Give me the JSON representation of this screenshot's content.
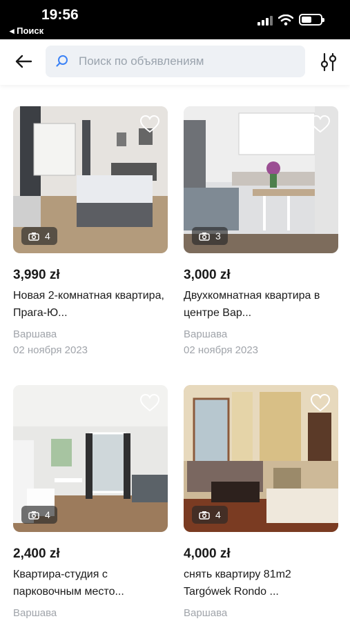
{
  "status_bar": {
    "time": "19:56",
    "back_label": "◂ Поиск"
  },
  "search": {
    "placeholder": "Поиск по объявлениям"
  },
  "listings": [
    {
      "price": "3,990 zł",
      "title": "Новая 2-комнатная квартира, Прага-Ю...",
      "city": "Варшава",
      "date": "02 ноября 2023",
      "photo_count": "4"
    },
    {
      "price": "3,000 zł",
      "title": "Двухкомнатная квартира в центре Вар...",
      "city": "Варшава",
      "date": "02 ноября 2023",
      "photo_count": "3"
    },
    {
      "price": "2,400 zł",
      "title": "Квартира-студия с парковочным место...",
      "city": "Варшава",
      "date": "",
      "photo_count": "4"
    },
    {
      "price": "4,000 zł",
      "title": "снять квартиру 81m2 Targówek Rondo ...",
      "city": "Варшава",
      "date": "",
      "photo_count": "4"
    }
  ],
  "colors": {
    "accent": "#3b82f6",
    "muted_text": "#a0a4aa",
    "search_bg": "#eef1f5"
  }
}
